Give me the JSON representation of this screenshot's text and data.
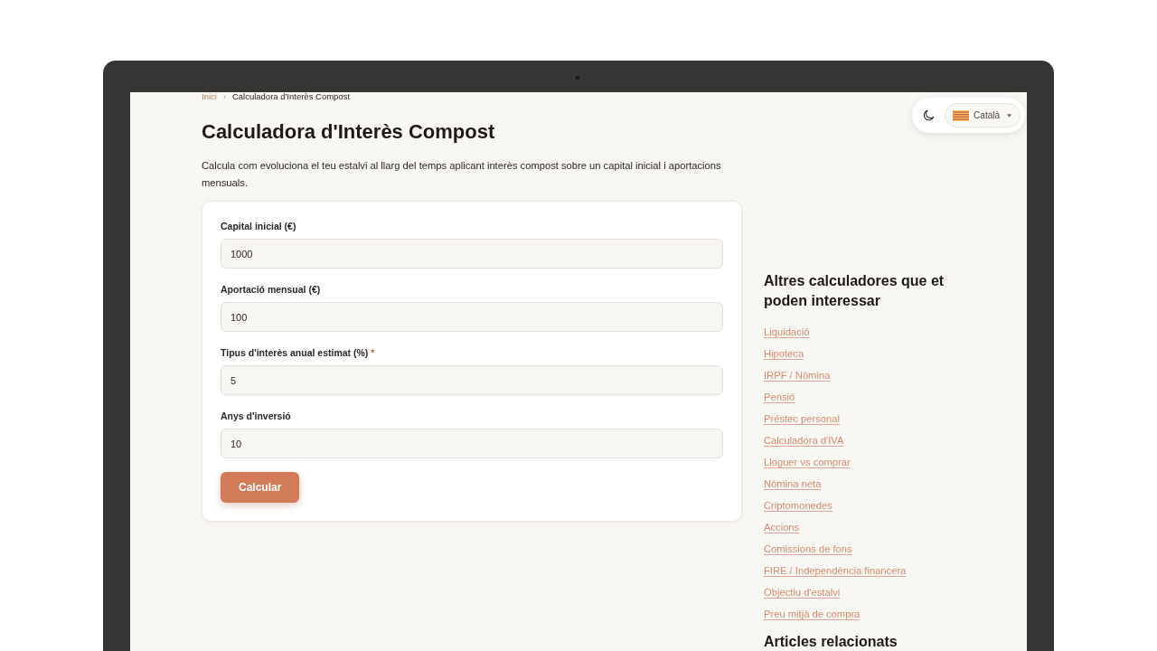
{
  "breadcrumb": {
    "separator": "›",
    "items": [
      {
        "label": "Inici",
        "kind": "link"
      },
      {
        "label": "Calculadora d'Interès Compost",
        "kind": "current"
      }
    ]
  },
  "header_controls": {
    "language": {
      "label": "Català"
    }
  },
  "page": {
    "title": "Calculadora d'Interès Compost",
    "description": "Calcula com evoluciona el teu estalvi al llarg del temps aplicant interès compost sobre un capital inicial i aportacions mensuals."
  },
  "form": {
    "fields": [
      {
        "label": "Capital inicial (€)",
        "value": "1000"
      },
      {
        "label": "Aportació mensual (€)",
        "value": "100"
      },
      {
        "label": "Tipus d'interès anual estimat (%)",
        "required_mark": "*",
        "value": "5"
      },
      {
        "label": "Anys d'inversió",
        "value": "10"
      }
    ],
    "submit": "Calcular"
  },
  "sidebar": {
    "title": "Altres calculadores que et poden interessar",
    "links": [
      "Liquidació",
      "Hipoteca",
      "IRPF / Nòmina",
      "Pensió",
      "Préstec personal",
      "Calculadora d'IVA",
      "Lloguer vs comprar",
      "Nòmina neta",
      "Criptomonedes",
      "Accions",
      "Comissions de fons",
      "FIRE / Independència financera",
      "Objectiu d'estalvi",
      "Preu mitjà de compra"
    ],
    "next_section_title": "Articles relacionats"
  }
}
